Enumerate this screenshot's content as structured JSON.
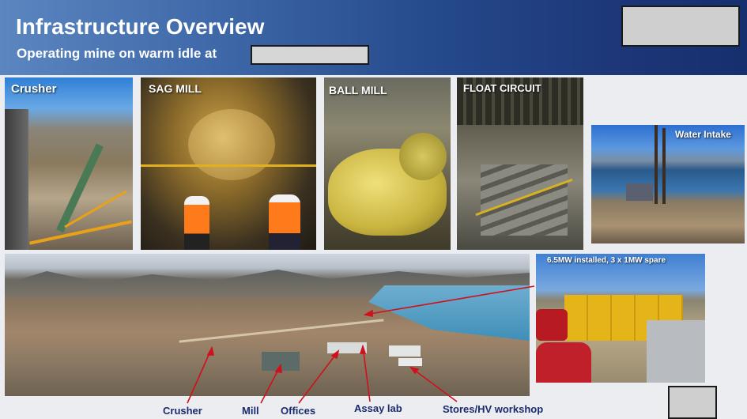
{
  "header": {
    "title": "Infrastructure Overview",
    "subtitle": "Operating mine on warm idle at"
  },
  "photos": {
    "crusher": "Crusher",
    "sag_mill": "SAG MILL",
    "ball_mill": "BALL MILL",
    "float_circuit": "FLOAT CIRCUIT",
    "water_intake": "Water Intake",
    "power": "6.5MW installed, 3 x 1MW spare"
  },
  "site_labels": {
    "crusher": "Crusher",
    "mill": "Mill",
    "offices": "Offices",
    "assay_lab": "Assay lab",
    "stores": "Stores/HV workshop"
  },
  "colors": {
    "header_gradient_start": "#5b86c0",
    "header_gradient_end": "#16306e",
    "label_navy": "#1a2b6d",
    "arrow_red": "#d0101a"
  }
}
